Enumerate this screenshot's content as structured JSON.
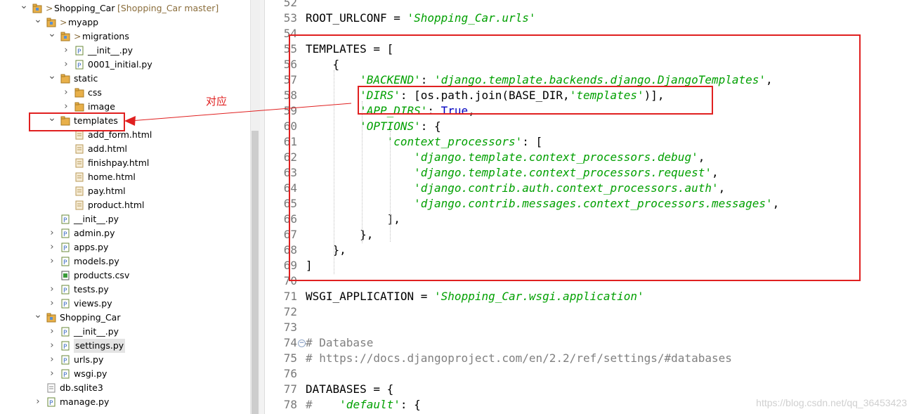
{
  "explorer": {
    "rows": [
      {
        "label": "Shopping_Car",
        "suffix": "[Shopping_Car master]",
        "prefix": ">",
        "twisty": "v"
      },
      {
        "label": "myapp",
        "prefix": ">",
        "twisty": "v"
      },
      {
        "label": "migrations",
        "prefix": ">",
        "twisty": "v"
      },
      {
        "label": "__init__.py",
        "twisty": ">"
      },
      {
        "label": "0001_initial.py",
        "twisty": ">"
      },
      {
        "label": "static",
        "twisty": "v"
      },
      {
        "label": "css",
        "twisty": ">"
      },
      {
        "label": "image",
        "twisty": ">"
      },
      {
        "label": "templates",
        "twisty": "v"
      },
      {
        "label": "add_form.html"
      },
      {
        "label": "add.html"
      },
      {
        "label": "finishpay.html"
      },
      {
        "label": "home.html"
      },
      {
        "label": "pay.html"
      },
      {
        "label": "product.html"
      },
      {
        "label": "__init__.py"
      },
      {
        "label": "admin.py",
        "twisty": ">"
      },
      {
        "label": "apps.py",
        "twisty": ">"
      },
      {
        "label": "models.py",
        "twisty": ">"
      },
      {
        "label": "products.csv"
      },
      {
        "label": "tests.py",
        "twisty": ">"
      },
      {
        "label": "views.py",
        "twisty": ">"
      },
      {
        "label": "Shopping_Car",
        "twisty": "v"
      },
      {
        "label": "__init__.py",
        "twisty": ">"
      },
      {
        "label": "settings.py",
        "twisty": ">"
      },
      {
        "label": "urls.py",
        "twisty": ">"
      },
      {
        "label": "wsgi.py",
        "twisty": ">"
      },
      {
        "label": "db.sqlite3"
      },
      {
        "label": "manage.py",
        "twisty": ">"
      }
    ]
  },
  "annotation": {
    "text": "对应"
  },
  "editor": {
    "lines": [
      {
        "n": "52",
        "parts": []
      },
      {
        "n": "53",
        "parts": [
          [
            "t",
            "ROOT_URLCONF = "
          ],
          [
            "s",
            "'Shopping_Car.urls'"
          ]
        ]
      },
      {
        "n": "54",
        "parts": []
      },
      {
        "n": "55",
        "parts": [
          [
            "t",
            "TEMPLATES = ["
          ]
        ]
      },
      {
        "n": "56",
        "parts": [
          [
            "t",
            "    {"
          ]
        ]
      },
      {
        "n": "57",
        "parts": [
          [
            "t",
            "        "
          ],
          [
            "s",
            "'BACKEND'"
          ],
          [
            "t",
            ": "
          ],
          [
            "s",
            "'django.template.backends.django.DjangoTemplates'"
          ],
          [
            "t",
            ","
          ]
        ]
      },
      {
        "n": "58",
        "parts": [
          [
            "t",
            "        "
          ],
          [
            "s",
            "'DIRS'"
          ],
          [
            "t",
            ": [os.path.join(BASE_DIR,"
          ],
          [
            "s",
            "'templates'"
          ],
          [
            "t",
            ")],"
          ]
        ]
      },
      {
        "n": "59",
        "parts": [
          [
            "t",
            "        "
          ],
          [
            "s",
            "'APP_DIRS'"
          ],
          [
            "t",
            ": "
          ],
          [
            "k",
            "True"
          ],
          [
            "t",
            ","
          ]
        ]
      },
      {
        "n": "60",
        "parts": [
          [
            "t",
            "        "
          ],
          [
            "s",
            "'OPTIONS'"
          ],
          [
            "t",
            ": {"
          ]
        ]
      },
      {
        "n": "61",
        "parts": [
          [
            "t",
            "            "
          ],
          [
            "s",
            "'context_processors'"
          ],
          [
            "t",
            ": ["
          ]
        ]
      },
      {
        "n": "62",
        "parts": [
          [
            "t",
            "                "
          ],
          [
            "s",
            "'django.template.context_processors.debug'"
          ],
          [
            "t",
            ","
          ]
        ]
      },
      {
        "n": "63",
        "parts": [
          [
            "t",
            "                "
          ],
          [
            "s",
            "'django.template.context_processors.request'"
          ],
          [
            "t",
            ","
          ]
        ]
      },
      {
        "n": "64",
        "parts": [
          [
            "t",
            "                "
          ],
          [
            "s",
            "'django.contrib.auth.context_processors.auth'"
          ],
          [
            "t",
            ","
          ]
        ]
      },
      {
        "n": "65",
        "parts": [
          [
            "t",
            "                "
          ],
          [
            "s",
            "'django.contrib.messages.context_processors.messages'"
          ],
          [
            "t",
            ","
          ]
        ]
      },
      {
        "n": "66",
        "parts": [
          [
            "t",
            "            ],"
          ]
        ]
      },
      {
        "n": "67",
        "parts": [
          [
            "t",
            "        },"
          ]
        ]
      },
      {
        "n": "68",
        "parts": [
          [
            "t",
            "    },"
          ]
        ]
      },
      {
        "n": "69",
        "parts": [
          [
            "t",
            "]"
          ]
        ]
      },
      {
        "n": "70",
        "parts": []
      },
      {
        "n": "71",
        "parts": [
          [
            "t",
            "WSGI_APPLICATION = "
          ],
          [
            "s",
            "'Shopping_Car.wsgi.application'"
          ]
        ]
      },
      {
        "n": "72",
        "parts": []
      },
      {
        "n": "73",
        "parts": []
      },
      {
        "n": "74",
        "parts": [
          [
            "c",
            "# Database"
          ]
        ],
        "fold": true
      },
      {
        "n": "75",
        "parts": [
          [
            "c",
            "# https://docs.djangoproject.com/en/2.2/ref/settings/#databases"
          ]
        ]
      },
      {
        "n": "76",
        "parts": []
      },
      {
        "n": "77",
        "parts": [
          [
            "t",
            "DATABASES = {"
          ]
        ]
      },
      {
        "n": "78",
        "parts": [
          [
            "c",
            "#    "
          ],
          [
            "s",
            "'default'"
          ],
          [
            "t",
            ": {"
          ]
        ]
      }
    ]
  },
  "watermark": "https://blog.csdn.net/qq_36453423"
}
